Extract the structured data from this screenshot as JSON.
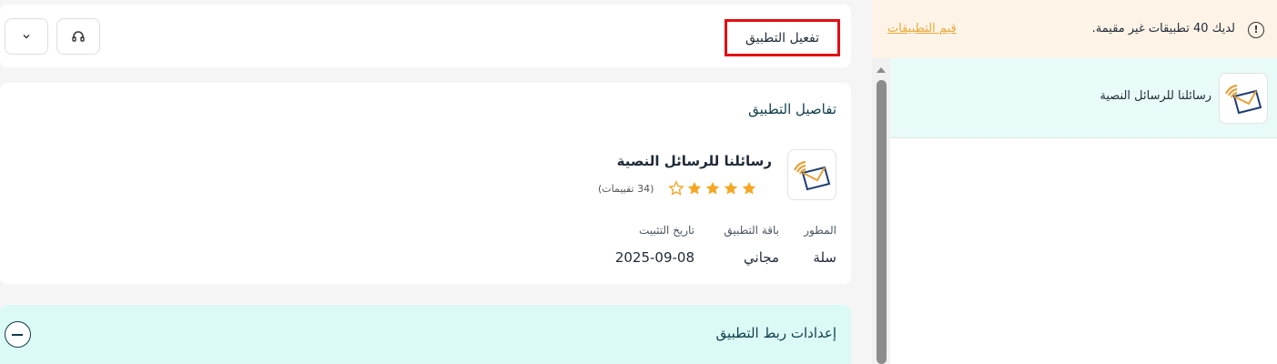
{
  "sidebar": {
    "notice": {
      "text": "لديك 40 تطبيقات غير مقيمة.",
      "link_label": "قيم التطبيقات"
    },
    "apps": [
      {
        "name": "رسائلنا للرسائل النصية",
        "logo_icon": "envelope-signal-icon"
      }
    ]
  },
  "topbar": {
    "activate_label": "تفعيل التطبيق",
    "headset_icon": "headset-icon",
    "dropdown_icon": "chevron-down-icon"
  },
  "details": {
    "title": "تفاصيل التطبيق",
    "app_name": "رسائلنا للرسائل النصية",
    "rating": 4,
    "rating_max": 5,
    "reviews": "(34 تقييمات)",
    "labels": {
      "developer": "المطور",
      "plan": "باقة التطبيق",
      "install_date": "تاريخ التثبيت"
    },
    "values": {
      "developer": "سلة",
      "plan": "مجاني",
      "install_date": "2025-09-08"
    }
  },
  "settings": {
    "title": "إعدادات ربط التطبيق"
  },
  "colors": {
    "accent_star": "#f5a623",
    "link_orange": "#e8a93a",
    "teal_dark": "#0f3d4c",
    "highlight_red": "#e10e14",
    "mint_bg": "#dcfaf5"
  }
}
